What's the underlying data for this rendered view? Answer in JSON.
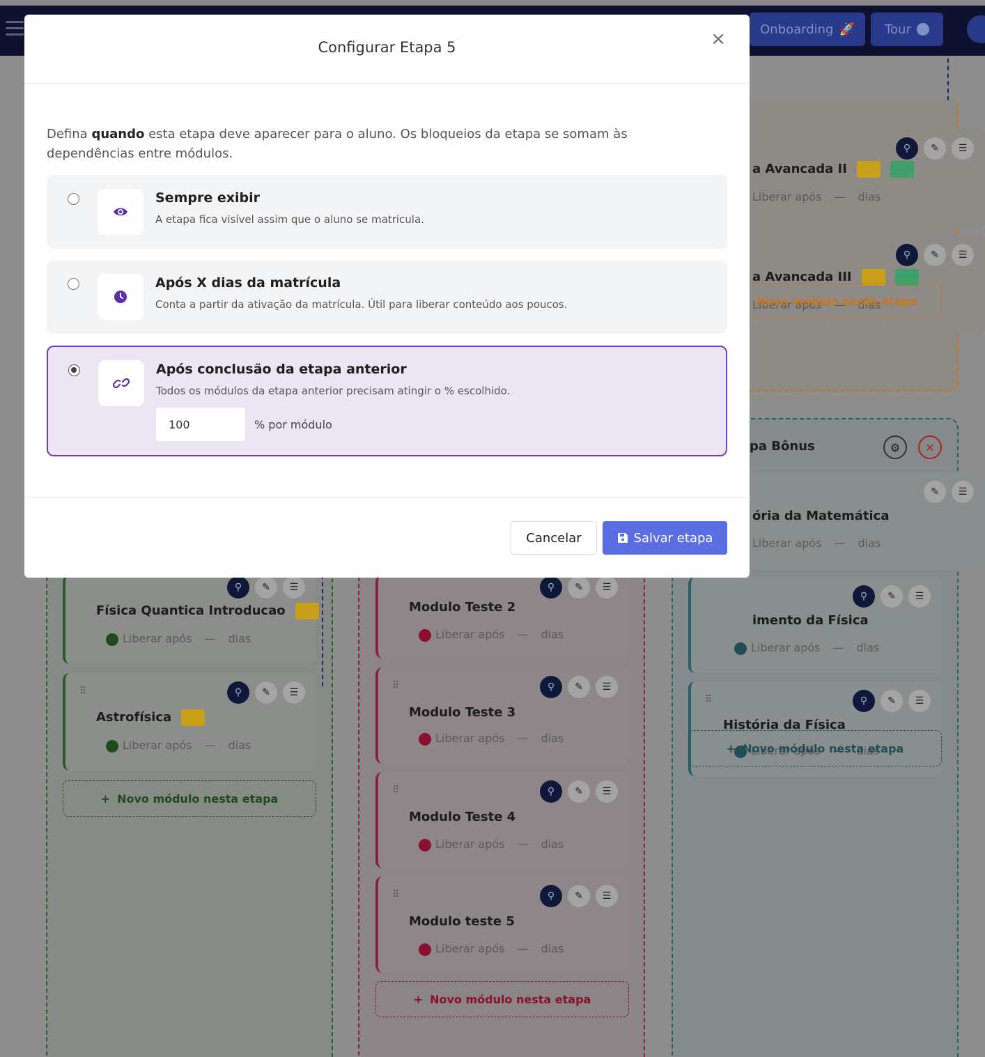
{
  "topbar": {
    "onboarding_label": "Onboarding",
    "tour_label": "Tour"
  },
  "board": {
    "orange_column": {
      "cards": [
        {
          "title": "a Avancada II",
          "release_label": "Liberar após",
          "dash": "—",
          "days": "dias",
          "lock_count": "1",
          "key_count": "1"
        },
        {
          "title": "a Avancada III",
          "release_label": "Liberar após",
          "dash": "—",
          "days": "dias",
          "lock_count": "1",
          "key_count": "1"
        }
      ],
      "new_module_label": "Novo módulo nesta etapa"
    },
    "teal_column": {
      "title": "pa Bônus",
      "cards": [
        {
          "title": "ória da Matemática",
          "release_label": "Liberar após",
          "dash": "—",
          "days": "dias"
        },
        {
          "title": "imento da Física",
          "release_label": "Liberar após",
          "dash": "—",
          "days": "dias"
        },
        {
          "title": "História da Física",
          "release_label": "Liberar após",
          "dash": "—",
          "days": "dias"
        }
      ],
      "new_module_label": "Novo módulo nesta etapa"
    },
    "green_column": {
      "cards": [
        {
          "title": "Física Quantica Introducao",
          "release_label": "Liberar após",
          "dash": "—",
          "days": "dias",
          "lock_count": "1"
        },
        {
          "title": "Astrofísica",
          "release_label": "Liberar após",
          "dash": "—",
          "days": "dias",
          "lock_count": "1"
        }
      ],
      "new_module_label": "Novo módulo nesta etapa"
    },
    "red_column": {
      "cards": [
        {
          "title": "Modulo Teste 2",
          "release_label": "Liberar após",
          "dash": "—",
          "days": "dias"
        },
        {
          "title": "Modulo Teste 3",
          "release_label": "Liberar após",
          "dash": "—",
          "days": "dias"
        },
        {
          "title": "Modulo Teste 4",
          "release_label": "Liberar após",
          "dash": "—",
          "days": "dias"
        },
        {
          "title": "Modulo teste 5",
          "release_label": "Liberar após",
          "dash": "—",
          "days": "dias"
        }
      ],
      "new_module_label": "Novo módulo nesta etapa"
    }
  },
  "modal": {
    "title": "Configurar Etapa 5",
    "close_glyph": "×",
    "description_prefix": "Defina ",
    "description_bold": "quando",
    "description_suffix": " esta etapa deve aparecer para o aluno. Os bloqueios da etapa se somam às dependências entre módulos.",
    "options": [
      {
        "title": "Sempre exibir",
        "subtitle": "A etapa fica visível assim que o aluno se matricula.",
        "icon": "eye-icon",
        "selected": false
      },
      {
        "title": "Após X dias da matrícula",
        "subtitle": "Conta a partir da ativação da matrícula. Útil para liberar conteúdo aos poucos.",
        "icon": "clock-icon",
        "selected": false
      },
      {
        "title": "Após conclusão da etapa anterior",
        "subtitle": "Todos os módulos da etapa anterior precisam atingir o % escolhido.",
        "icon": "link-icon",
        "selected": true
      }
    ],
    "percent_value": "100",
    "percent_label": "% por módulo",
    "cancel_label": "Cancelar",
    "save_label": "Salvar etapa"
  },
  "colors": {
    "accent_purple": "#6d3fc0",
    "save_button": "#5b6ee1",
    "selected_bg": "#ece5f4"
  }
}
